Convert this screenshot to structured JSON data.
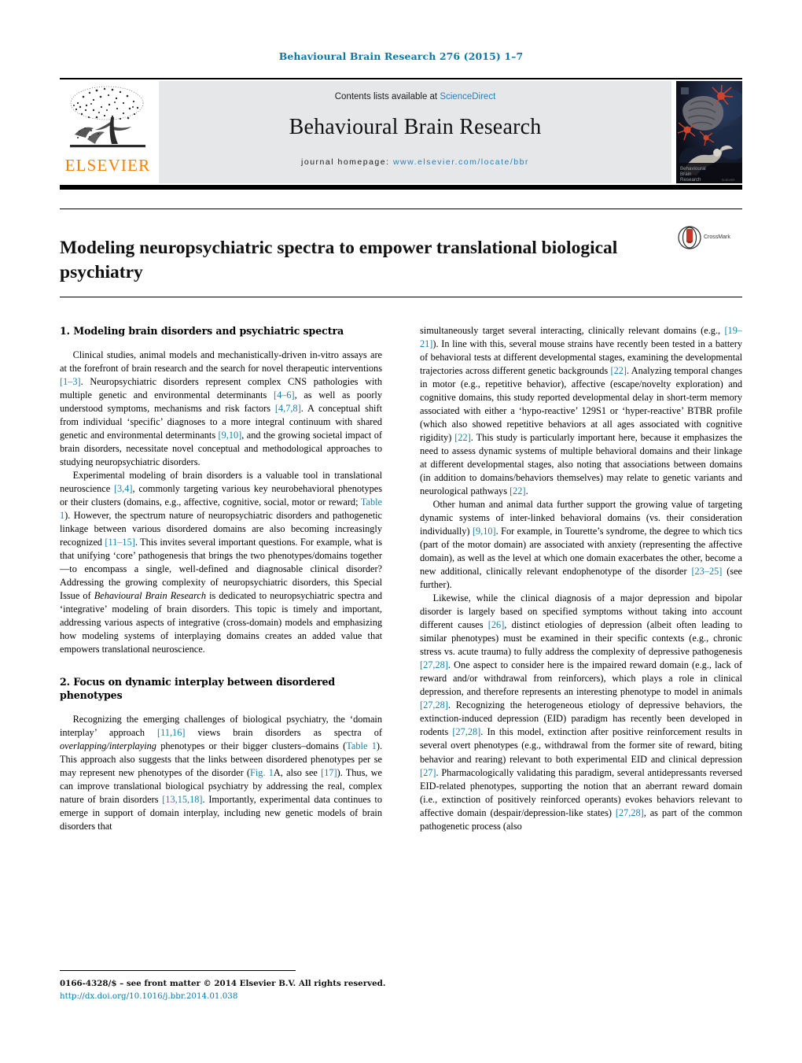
{
  "running_head": "Behavioural Brain Research 276 (2015) 1–7",
  "masthead": {
    "contents_prefix": "Contents lists available at ",
    "sciencedirect": "ScienceDirect",
    "journal_title": "Behavioural Brain Research",
    "homepage_prefix": "journal homepage: ",
    "homepage_url": "www.elsevier.com/locate/bbr",
    "publisher_name": "ELSEVIER",
    "publisher_logo_icon": "elsevier-tree-icon",
    "cover_icon": "journal-cover-thumbnail",
    "cover_title_lines": [
      "Behavioural",
      "Brain",
      "Research"
    ]
  },
  "article": {
    "title": "Modeling neuropsychiatric spectra to empower translational biological psychiatry",
    "crossmark_label": "CrossMark",
    "crossmark_icon": "crossmark-badge-icon"
  },
  "sections": {
    "s1_heading": "1.  Modeling brain disorders and psychiatric spectra",
    "s2_heading": "2.  Focus on dynamic interplay between disordered phenotypes"
  },
  "left_column": {
    "p1": {
      "t1": "Clinical studies, animal models and mechanistically-driven in-vitro assays are at the forefront of brain research and the search for novel therapeutic interventions ",
      "r1": "[1–3]",
      "t2": ". Neuropsychiatric disorders represent complex CNS pathologies with multiple genetic and environmental determinants ",
      "r2": "[4–6]",
      "t3": ", as well as poorly understood symptoms, mechanisms and risk factors ",
      "r3": "[4,7,8]",
      "t4": ". A conceptual shift from individual ‘specific’ diagnoses to a more integral continuum with shared genetic and environmental determinants ",
      "r4": "[9,10]",
      "t5": ", and the growing societal impact of brain disorders, necessitate novel conceptual and methodological approaches to studying neuropsychiatric disorders."
    },
    "p2": {
      "t1": "Experimental modeling of brain disorders is a valuable tool in translational neuroscience ",
      "r1": "[3,4]",
      "t2": ", commonly targeting various key neurobehavioral phenotypes or their clusters (domains, e.g., affective, cognitive, social, motor or reward; ",
      "r2": "Table 1",
      "t3": "). However, the spectrum nature of neuropsychiatric disorders and pathogenetic linkage between various disordered domains are also becoming increasingly recognized ",
      "r3": "[11–15]",
      "t4": ". This invites several important questions. For example, what is that unifying ‘core’ pathogenesis that brings the two phenotypes/domains together—to encompass a single, well-defined and diagnosable clinical disorder? Addressing the growing complexity of neuropsychiatric disorders, this Special Issue of ",
      "i1": "Behavioural Brain Research",
      "t5": " is dedicated to neuropsychiatric spectra and ‘integrative’ modeling of brain disorders. This topic is timely and important, addressing various aspects of integrative (cross-domain) models and emphasizing how modeling systems of interplaying domains creates an added value that empowers translational neuroscience."
    },
    "p3": {
      "t1": "Recognizing the emerging challenges of biological psychiatry, the ‘domain interplay’ approach ",
      "r1": "[11,16]",
      "t2": " views brain disorders as spectra of ",
      "i1": "overlapping/interplaying",
      "t3": " phenotypes or their bigger clusters–domains (",
      "r2": "Table 1",
      "t4": "). This approach also suggests that the links between disordered phenotypes per se may represent new phenotypes of the disorder (",
      "r3": "Fig. 1",
      "t5": "A, also see ",
      "r4": "[17]",
      "t6": "). Thus, we can improve translational biological psychiatry by addressing the real, complex nature of brain disorders ",
      "r5": "[13,15,18]",
      "t7": ". Importantly, experimental data continues to emerge in support of domain interplay, including new genetic models of brain disorders that"
    }
  },
  "right_column": {
    "p1": {
      "t1": "simultaneously target several interacting, clinically relevant domains (e.g., ",
      "r1": "[19–21]",
      "t2": "). In line with this, several mouse strains have recently been tested in a battery of behavioral tests at different developmental stages, examining the developmental trajectories across different genetic backgrounds ",
      "r2": "[22]",
      "t3": ". Analyzing temporal changes in motor (e.g., repetitive behavior), affective (escape/novelty exploration) and cognitive domains, this study reported developmental delay in short-term memory associated with either a ‘hypo-reactive’ 129S1 or ‘hyper-reactive’ BTBR profile (which also showed repetitive behaviors at all ages associated with cognitive rigidity) ",
      "r3": "[22]",
      "t4": ". This study is particularly important here, because it emphasizes the need to assess dynamic systems of multiple behavioral domains and their linkage at different developmental stages, also noting that associations between domains (in addition to domains/behaviors themselves) may relate to genetic variants and neurological pathways ",
      "r4": "[22]",
      "t5": "."
    },
    "p2": {
      "t1": "Other human and animal data further support the growing value of targeting dynamic systems of inter-linked behavioral domains (vs. their consideration individually) ",
      "r1": "[9,10]",
      "t2": ". For example, in Tourette’s syndrome, the degree to which tics (part of the motor domain) are associated with anxiety (representing the affective domain), as well as the level at which one domain exacerbates the other, become a new additional, clinically relevant endophenotype of the disorder ",
      "r2": "[23–25]",
      "t3": " (see further)."
    },
    "p3": {
      "t1": "Likewise, while the clinical diagnosis of a major depression and bipolar disorder is largely based on specified symptoms without taking into account different causes ",
      "r1": "[26]",
      "t2": ", distinct etiologies of depression (albeit often leading to similar phenotypes) must be examined in their specific contexts (e.g., chronic stress vs. acute trauma) to fully address the complexity of depressive pathogenesis ",
      "r2": "[27,28]",
      "t3": ". One aspect to consider here is the impaired reward domain (e.g., lack of reward and/or withdrawal from reinforcers), which plays a role in clinical depression, and therefore represents an interesting phenotype to model in animals ",
      "r3": "[27,28]",
      "t4": ". Recognizing the heterogeneous etiology of depressive behaviors, the extinction-induced depression (EID) paradigm has recently been developed in rodents ",
      "r4": "[27,28]",
      "t5": ". In this model, extinction after positive reinforcement results in several overt phenotypes (e.g., withdrawal from the former site of reward, biting behavior and rearing) relevant to both experimental EID and clinical depression ",
      "r5": "[27]",
      "t6": ". Pharmacologically validating this paradigm, several antidepressants reversed EID-related phenotypes, supporting the notion that an aberrant reward domain (i.e., extinction of positively reinforced operants) evokes behaviors relevant to affective domain (despair/depression-like states) ",
      "r6": "[27,28]",
      "t7": ", as part of the common pathogenetic process (also"
    }
  },
  "footer": {
    "copyright": "0166-4328/$ – see front matter © 2014 Elsevier B.V. All rights reserved.",
    "doi": "http://dx.doi.org/10.1016/j.bbr.2014.01.038"
  },
  "colors": {
    "link": "#1a7fa8",
    "elsevier_orange": "#f08000",
    "band_gray": "#e6e7e8",
    "sciencedirect_blue": "#2a7fb5"
  }
}
